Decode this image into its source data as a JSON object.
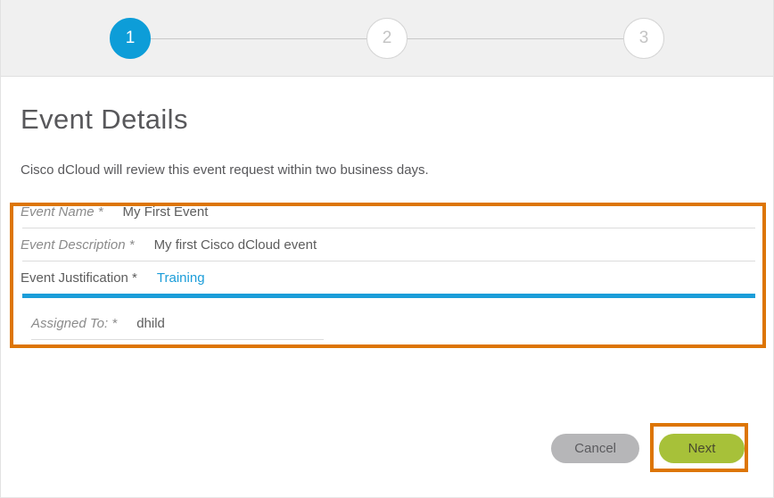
{
  "wizard": {
    "steps": [
      {
        "number": "1",
        "state": "active"
      },
      {
        "number": "2",
        "state": "inactive"
      },
      {
        "number": "3",
        "state": "inactive"
      }
    ]
  },
  "page": {
    "title": "Event Details",
    "intro": "Cisco dCloud will review this event request within two business days."
  },
  "form": {
    "fields": [
      {
        "label": "Event Name *",
        "value": "My First Event"
      },
      {
        "label": "Event Description *",
        "value": "My first Cisco dCloud event"
      },
      {
        "label": "Event Justification *",
        "value": "Training"
      },
      {
        "label": "Assigned To: *",
        "value": "dhild"
      }
    ]
  },
  "buttons": {
    "cancel_label": "Cancel",
    "next_label": "Next"
  },
  "colors": {
    "accent_blue": "#0d9dd8",
    "underline_blue": "#1b9dd9",
    "highlight_orange": "#dd7504",
    "next_green": "#a7c139",
    "cancel_gray": "#b6b6b8",
    "header_bg": "#f0f0f0",
    "text_gray": "#58585b",
    "label_gray": "#8b8b8b"
  }
}
